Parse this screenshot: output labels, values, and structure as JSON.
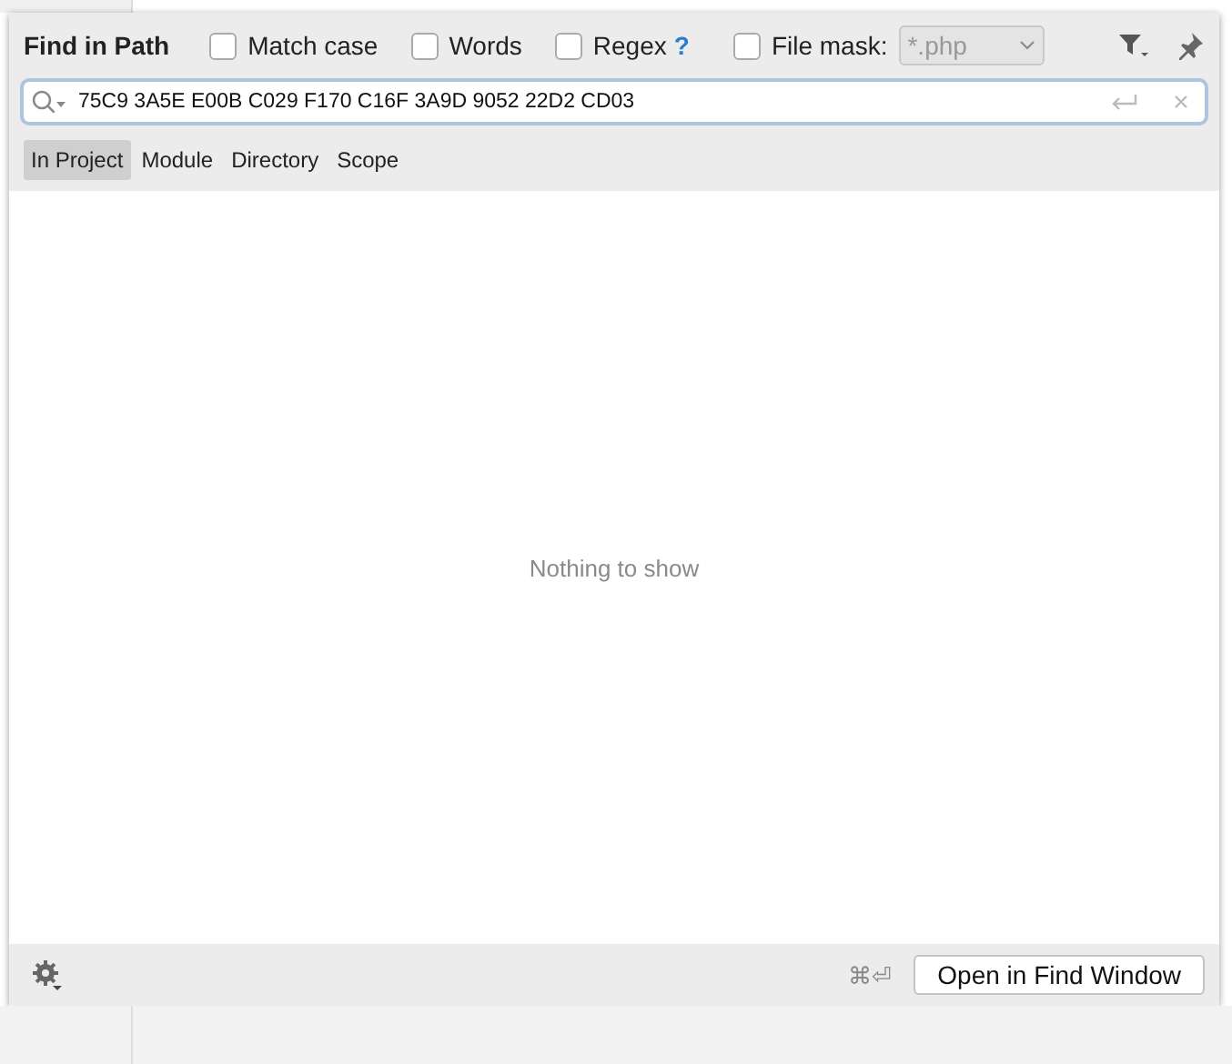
{
  "dialog": {
    "title": "Find in Path",
    "options": [
      {
        "label": "Match case",
        "checked": false,
        "kind": "checkbox"
      },
      {
        "label": "Words",
        "checked": false,
        "kind": "checkbox"
      },
      {
        "label": "Regex",
        "checked": false,
        "kind": "checkbox",
        "help": "?"
      }
    ],
    "file_mask": {
      "label": "File mask:",
      "checked": false,
      "value": "*.php"
    },
    "search": {
      "value": "75C9 3A5E E00B C029 F170 C16F 3A9D 9052 22D2 CD03"
    },
    "scopes": [
      {
        "label": "In Project",
        "selected": true
      },
      {
        "label": "Module",
        "selected": false
      },
      {
        "label": "Directory",
        "selected": false
      },
      {
        "label": "Scope",
        "selected": false
      }
    ],
    "empty_message": "Nothing to show",
    "footer": {
      "shortcut": "⌘⏎",
      "button": "Open in Find Window"
    }
  }
}
